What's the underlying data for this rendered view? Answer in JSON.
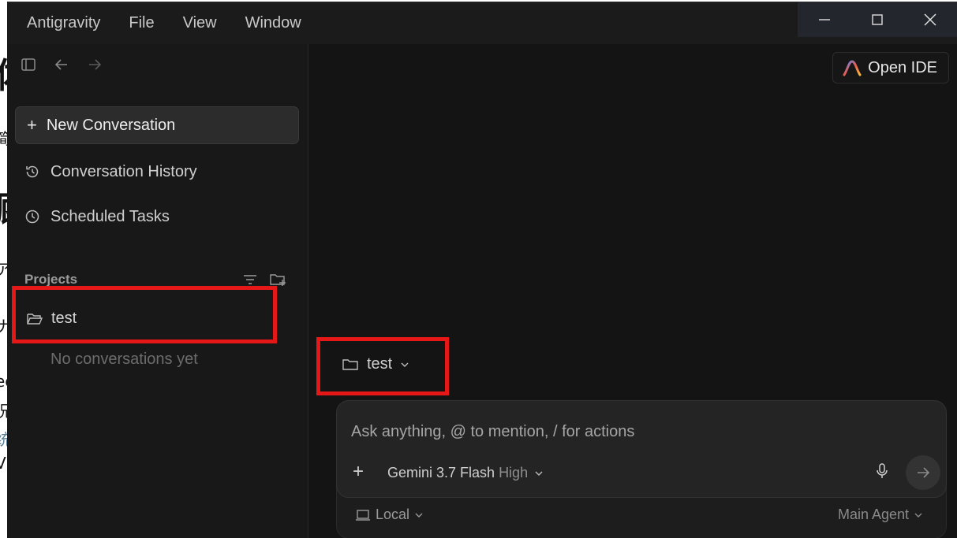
{
  "menu": [
    "Antigravity",
    "File",
    "View",
    "Window"
  ],
  "sidebar": {
    "new_conversation": "New Conversation",
    "items": [
      {
        "label": "Conversation History",
        "icon": "history-icon"
      },
      {
        "label": "Scheduled Tasks",
        "icon": "clock-icon"
      }
    ],
    "projects_title": "Projects",
    "project_name": "test",
    "empty_text": "No conversations yet"
  },
  "main": {
    "open_ide_label": "Open IDE",
    "folder_label": "test",
    "prompt_placeholder": "Ask anything, @ to mention, / for actions",
    "model_name": "Gemini 3.7 Flash",
    "model_level": "High",
    "env_label": "Local",
    "agent_label": "Main Agent"
  },
  "colors": {
    "highlight": "#e61717",
    "background": "#141414",
    "sidebar": "#181818"
  }
}
